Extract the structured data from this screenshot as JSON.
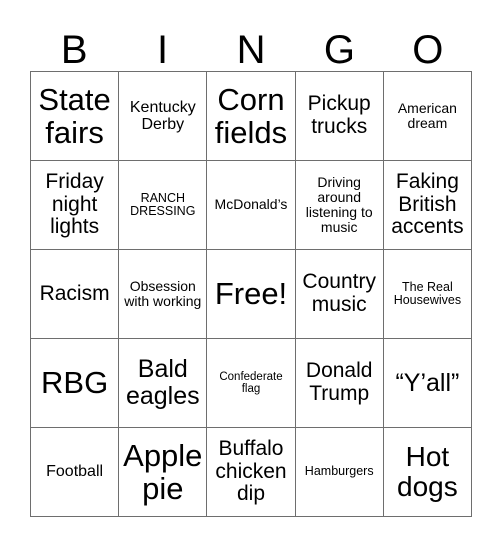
{
  "card": {
    "title_letters": [
      "B",
      "I",
      "N",
      "G",
      "O"
    ],
    "free_space_label": "Free!",
    "rows": [
      [
        {
          "text": "State fairs",
          "size": "s-xxl"
        },
        {
          "text": "Kentucky Derby",
          "size": "s-s"
        },
        {
          "text": "Corn fields",
          "size": "s-xxl"
        },
        {
          "text": "Pickup trucks",
          "size": "s-m"
        },
        {
          "text": "American dream",
          "size": "s-xs"
        }
      ],
      [
        {
          "text": "Friday night lights",
          "size": "s-m"
        },
        {
          "text": "RANCH DRESSING",
          "size": "s-xxs"
        },
        {
          "text": "McDonald’s",
          "size": "s-xs"
        },
        {
          "text": "Driving around listening to music",
          "size": "s-xs"
        },
        {
          "text": "Faking British accents",
          "size": "s-m"
        }
      ],
      [
        {
          "text": "Racism",
          "size": "s-m"
        },
        {
          "text": "Obsession with working",
          "size": "s-xs"
        },
        {
          "text": "Free!",
          "size": "s-xxl"
        },
        {
          "text": "Country music",
          "size": "s-m"
        },
        {
          "text": "The Real Housewives",
          "size": "s-xxs"
        }
      ],
      [
        {
          "text": "RBG",
          "size": "s-xxl"
        },
        {
          "text": "Bald eagles",
          "size": "s-l"
        },
        {
          "text": "Confederate flag",
          "size": "s-tiny"
        },
        {
          "text": "Donald Trump",
          "size": "s-m"
        },
        {
          "text": "“Y’all”",
          "size": "s-l"
        }
      ],
      [
        {
          "text": "Football",
          "size": "s-s"
        },
        {
          "text": "Apple pie",
          "size": "s-xxl"
        },
        {
          "text": "Buffalo chicken dip",
          "size": "s-m"
        },
        {
          "text": "Hamburgers",
          "size": "s-xxs"
        },
        {
          "text": "Hot dogs",
          "size": "s-xl"
        }
      ]
    ]
  },
  "colors": {
    "background": "#ffffff",
    "text": "#000000",
    "grid_line": "#6e6e6e"
  }
}
